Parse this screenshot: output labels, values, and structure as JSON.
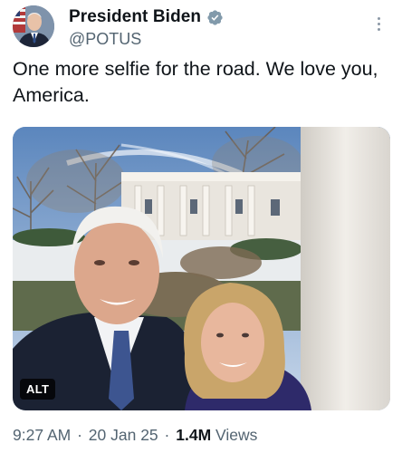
{
  "author": {
    "name": "President Biden",
    "handle": "@POTUS",
    "verified_color": "#829AAB",
    "avatar_icon": "portrait-avatar"
  },
  "tweet": {
    "text": "One more selfie for the road. We love you, America."
  },
  "media": {
    "alt_label": "ALT"
  },
  "meta": {
    "time": "9:27 AM",
    "date": "20 Jan 25",
    "separator": "·",
    "views_count": "1.4M",
    "views_label": "Views"
  },
  "colors": {
    "text": "#0f1419",
    "secondary": "#536471"
  }
}
